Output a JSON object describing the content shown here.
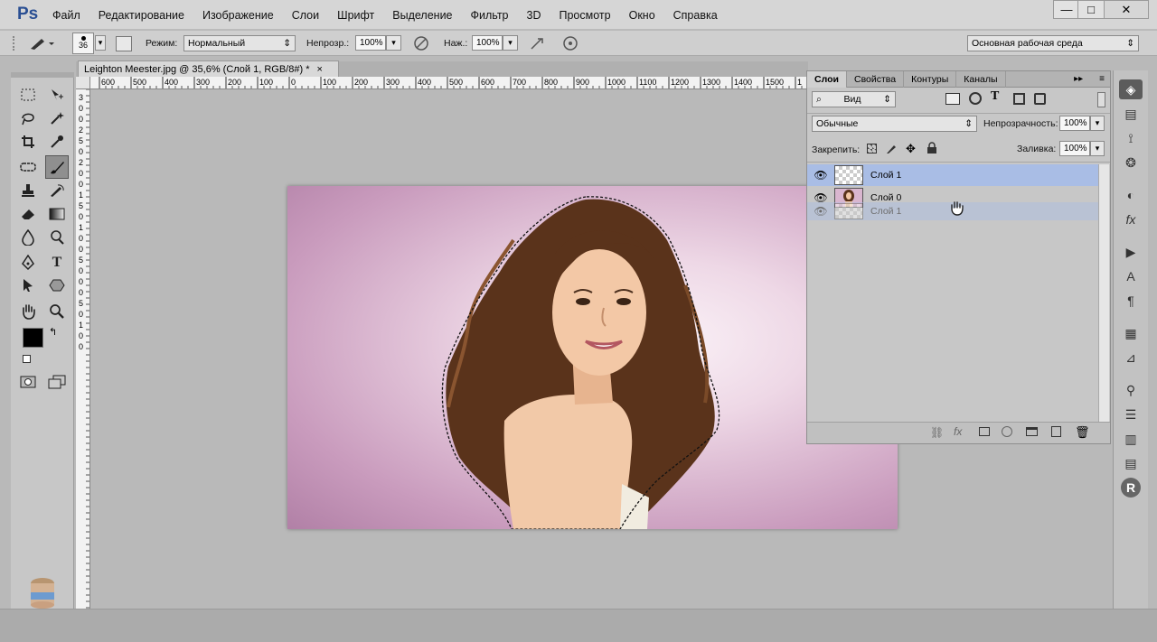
{
  "app": {
    "logo": "Ps"
  },
  "menu": [
    "Файл",
    "Редактирование",
    "Изображение",
    "Слои",
    "Шрифт",
    "Выделение",
    "Фильтр",
    "3D",
    "Просмотр",
    "Окно",
    "Справка"
  ],
  "window_controls": {
    "minimize": "—",
    "maximize": "□",
    "close": "✕"
  },
  "options": {
    "brush_size": "36",
    "mode_label": "Режим:",
    "mode_value": "Нормальный",
    "opacity_label": "Непрозр.:",
    "opacity_value": "100%",
    "flow_label": "Наж.:",
    "flow_value": "100%",
    "workspace": "Основная рабочая среда"
  },
  "document": {
    "tab_title": "Leighton Meester.jpg @ 35,6% (Слой 1, RGB/8#) *",
    "close": "×",
    "ruler_h": [
      "600",
      "500",
      "400",
      "300",
      "200",
      "100",
      "0",
      "100",
      "200",
      "300",
      "400",
      "500",
      "600",
      "700",
      "800",
      "900",
      "1000",
      "1100",
      "1200",
      "1300",
      "1400",
      "1500",
      "1"
    ],
    "ruler_v": [
      "3",
      "0",
      "0",
      "2",
      "5",
      "0",
      "2",
      "0",
      "0",
      "1",
      "5",
      "0",
      "1",
      "0",
      "0",
      "5",
      "0",
      "0",
      "0",
      "5",
      "0",
      "1",
      "0",
      "0"
    ]
  },
  "layers_panel": {
    "tabs": [
      "Слои",
      "Свойства",
      "Контуры",
      "Каналы"
    ],
    "filter": "Вид",
    "blend_mode": "Обычные",
    "opacity_label": "Непрозрачность:",
    "opacity_value": "100%",
    "lock_label": "Закрепить:",
    "fill_label": "Заливка:",
    "fill_value": "100%",
    "layers": [
      {
        "name": "Слой 1",
        "selected": true
      },
      {
        "name": "Слой 0",
        "selected": false
      },
      {
        "name": "Слой 1",
        "selected": false,
        "ghost": true
      }
    ]
  },
  "colors": {
    "accent_selection": "#a9bde5",
    "foreground": "#000000",
    "background": "#ffffff"
  }
}
